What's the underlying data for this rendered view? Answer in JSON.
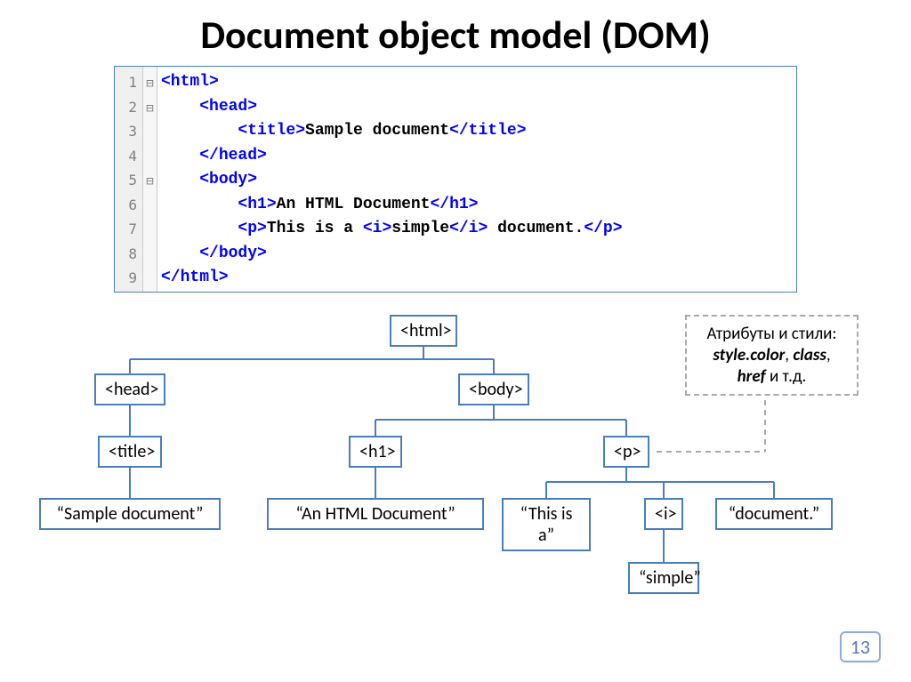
{
  "title": "Document object model (DOM)",
  "code": {
    "line_numbers": [
      "1",
      "2",
      "3",
      "4",
      "5",
      "6",
      "7",
      "8",
      "9"
    ],
    "fold_markers": [
      "⊟",
      "⊟",
      "",
      "",
      "⊟",
      "",
      "",
      "",
      ""
    ],
    "lines": [
      [
        {
          "t": "tag",
          "v": "<html>"
        }
      ],
      [
        {
          "t": "pad",
          "v": "    "
        },
        {
          "t": "tag",
          "v": "<head>"
        }
      ],
      [
        {
          "t": "pad",
          "v": "        "
        },
        {
          "t": "tag",
          "v": "<title>"
        },
        {
          "t": "txt",
          "v": "Sample document"
        },
        {
          "t": "tag",
          "v": "</title>"
        }
      ],
      [
        {
          "t": "pad",
          "v": "    "
        },
        {
          "t": "tag",
          "v": "</head>"
        }
      ],
      [
        {
          "t": "pad",
          "v": "    "
        },
        {
          "t": "tag",
          "v": "<body>"
        }
      ],
      [
        {
          "t": "pad",
          "v": "        "
        },
        {
          "t": "tag",
          "v": "<h1>"
        },
        {
          "t": "txt",
          "v": "An HTML Document"
        },
        {
          "t": "tag",
          "v": "</h1>"
        }
      ],
      [
        {
          "t": "pad",
          "v": "        "
        },
        {
          "t": "tag",
          "v": "<p>"
        },
        {
          "t": "txt",
          "v": "This is a "
        },
        {
          "t": "tag",
          "v": "<i>"
        },
        {
          "t": "txt",
          "v": "simple"
        },
        {
          "t": "tag",
          "v": "</i>"
        },
        {
          "t": "txt",
          "v": " document."
        },
        {
          "t": "tag",
          "v": "</p>"
        }
      ],
      [
        {
          "t": "pad",
          "v": "    "
        },
        {
          "t": "tag",
          "v": "</body>"
        }
      ],
      [
        {
          "t": "tag",
          "v": "</html>"
        }
      ]
    ]
  },
  "tree": {
    "html": "<html>",
    "head": "<head>",
    "body": "<body>",
    "title": "<title>",
    "h1": "<h1>",
    "p": "<p>",
    "i": "<i>",
    "sample_doc": "“Sample document”",
    "an_html_doc": "“An HTML Document”",
    "this_is_a": "“This is a”",
    "document": "“document.”",
    "simple": "“simple”"
  },
  "attr_box": {
    "line1": "Атрибуты и стили:",
    "style_color": "style.color",
    "sep1": ", ",
    "class": "class",
    "sep2": ", ",
    "href": "href",
    "tail": " и т.д."
  },
  "page_number": "13"
}
